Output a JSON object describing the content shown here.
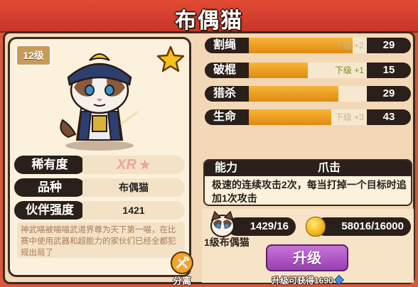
{
  "title": "布偶猫",
  "card": {
    "level": "12级",
    "rarity_label": "稀有度",
    "rarity_value": "XR",
    "breed_label": "品种",
    "breed_value": "布偶猫",
    "power_label": "伙伴强度",
    "power_value": "1421",
    "description": "神武喵被喵喵武道界尊为天下第一喵，在比赛中使用武器和超能力的家伙们已经全都犯规出局了",
    "split_label": "分离",
    "icons": [
      "star-icon",
      "samurai-cat-portrait",
      "wrench-icon"
    ]
  },
  "stats": [
    {
      "label": "割绳",
      "sub": "下级 +2",
      "value": "29",
      "fill": 0.88,
      "sub_highlight": false
    },
    {
      "label": "破棍",
      "sub": "下级 +1",
      "value": "15",
      "fill": 0.5,
      "sub_highlight": true
    },
    {
      "label": "猎杀",
      "sub": "",
      "value": "29",
      "fill": 0.76,
      "sub_highlight": false
    },
    {
      "label": "生命",
      "sub": "下级 +3",
      "value": "43",
      "fill": 0.7,
      "sub_highlight": false
    }
  ],
  "ability": {
    "label": "能力",
    "name": "爪击",
    "text": "极速的连续攻击2次，每当打掉一个目标时追加1次攻击"
  },
  "upgrade": {
    "shard_count": "1429/16",
    "shard_name": "1级布偶猫",
    "coins": "58016/16000",
    "button_label": "升级",
    "reward_text": "升级可获得1690"
  },
  "colors": {
    "accent": "#f2a52a",
    "button": "#b35acb",
    "header": "#d9412e"
  }
}
